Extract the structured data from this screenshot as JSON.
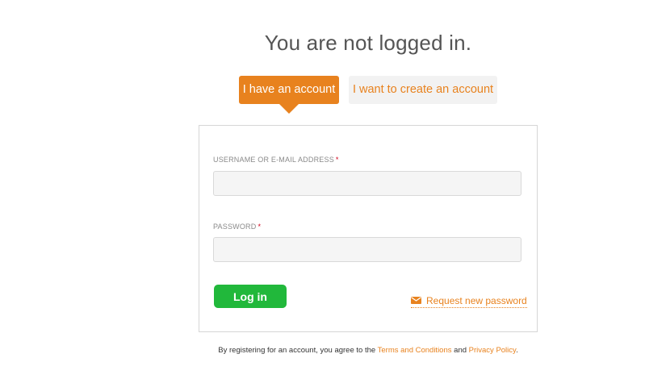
{
  "header": {
    "title": "You are not logged in."
  },
  "tabs": [
    {
      "label": "I have an account",
      "active": true
    },
    {
      "label": "I want to create an account",
      "active": false
    }
  ],
  "login_form": {
    "username": {
      "label": "USERNAME OR E-MAIL ADDRESS",
      "required_marker": "*",
      "value": "",
      "placeholder": ""
    },
    "password": {
      "label": "PASSWORD",
      "required_marker": "*",
      "value": "",
      "placeholder": ""
    },
    "submit_label": "Log in",
    "forgot_link": {
      "label": "Request new password",
      "icon": "envelope-icon"
    }
  },
  "footer": {
    "terms_prefix": "By registering for an account, you agree to the",
    "terms_link": "Terms and Conditions",
    "conjunction": "and",
    "privacy_link": "Privacy Policy",
    "terms_suffix": "."
  },
  "colors": {
    "accent": "#e8821e",
    "success": "#21b83b",
    "required": "#d0021b"
  }
}
